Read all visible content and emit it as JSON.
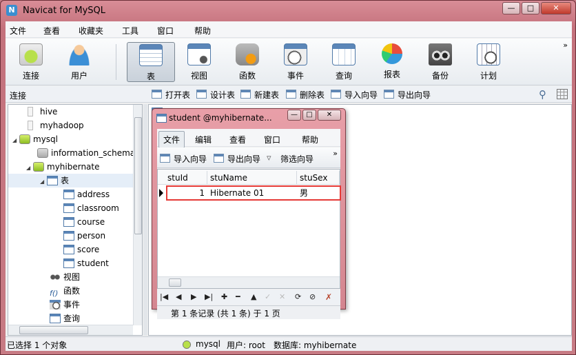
{
  "window": {
    "title": "Navicat for MySQL",
    "min": "—",
    "max": "□",
    "close": "✕"
  },
  "menubar": [
    "文件",
    "查看",
    "收藏夹",
    "工具",
    "窗口",
    "帮助"
  ],
  "toolbar": {
    "items": [
      {
        "label": "连接",
        "icon": "connection-icon"
      },
      {
        "label": "用户",
        "icon": "user-icon"
      },
      {
        "label": "表",
        "icon": "table-icon"
      },
      {
        "label": "视图",
        "icon": "view-icon"
      },
      {
        "label": "函数",
        "icon": "function-icon"
      },
      {
        "label": "事件",
        "icon": "event-icon"
      },
      {
        "label": "查询",
        "icon": "query-icon"
      },
      {
        "label": "报表",
        "icon": "report-icon"
      },
      {
        "label": "备份",
        "icon": "backup-icon"
      },
      {
        "label": "计划",
        "icon": "schedule-icon"
      }
    ],
    "more": "»"
  },
  "subbar": {
    "connection_label": "连接",
    "buttons": [
      "打开表",
      "设计表",
      "新建表",
      "删除表",
      "导入向导",
      "导出向导"
    ]
  },
  "tree": {
    "items": [
      {
        "label": "hive"
      },
      {
        "label": "myhadoop"
      },
      {
        "label": "mysql",
        "arrow": "◢"
      },
      {
        "label": "information_schema"
      },
      {
        "label": "myhibernate",
        "arrow": "◢"
      },
      {
        "label": "表",
        "arrow": "◢"
      },
      {
        "label": "address"
      },
      {
        "label": "classroom"
      },
      {
        "label": "course"
      },
      {
        "label": "person"
      },
      {
        "label": "score"
      },
      {
        "label": "student"
      },
      {
        "label": "视图"
      },
      {
        "label": "函数"
      },
      {
        "label": "事件"
      },
      {
        "label": "查询"
      }
    ]
  },
  "statusbar": {
    "selection": "已选择 1 个对象",
    "connection": "mysql",
    "user": "用户: root",
    "database": "数据库: myhibernate"
  },
  "child_window": {
    "title": "student @myhibernate...",
    "menu": [
      "文件",
      "编辑",
      "查看",
      "窗口",
      "帮助"
    ],
    "toolbar": [
      "导入向导",
      "导出向导",
      "筛选向导"
    ],
    "more": "»",
    "columns": [
      "stuId",
      "stuName",
      "stuSex"
    ],
    "rows": [
      {
        "stuId": "1",
        "stuName": "Hibernate 01",
        "stuSex": "男"
      }
    ],
    "nav": [
      "|◀",
      "◀",
      "▶",
      "▶|",
      "✚",
      "━",
      "▲",
      "✓",
      "✕",
      "⟳",
      "⊘"
    ],
    "status": "第 1 条记录 (共 1 条) 于 1 页"
  }
}
